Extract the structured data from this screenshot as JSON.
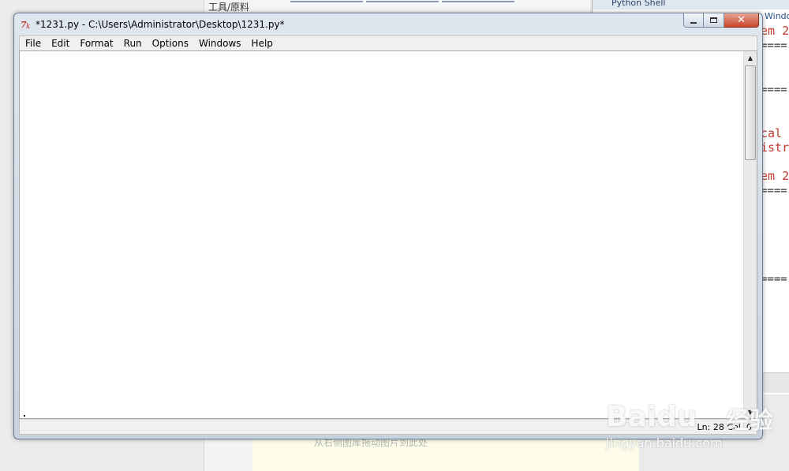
{
  "background": {
    "tool_panel_label": "工具/原料",
    "hint_text": "从右侧图库拖动图片到此处",
    "shell_window_title": "Python Shell",
    "shell_window_caption": "Windo",
    "shell_lines": [
      "em 2",
      "",
      "",
      "",
      " cal",
      "istr",
      "",
      "em 2",
      "",
      "",
      ""
    ]
  },
  "window": {
    "title": "*1231.py - C:\\Users\\Administrator\\Desktop\\1231.py*",
    "controls": {
      "minimize": "",
      "maximize": "",
      "close": "✕"
    }
  },
  "menu": {
    "items": [
      "File",
      "Edit",
      "Format",
      "Run",
      "Options",
      "Windows",
      "Help"
    ]
  },
  "editor": {
    "content": ""
  },
  "status": {
    "text": "Ln: 28 Col: 0"
  },
  "watermark": {
    "brand": "Baidu",
    "brand_cn": "经验",
    "url": "jingyan.baidu.com"
  },
  "colors": {
    "shell_error_red": "#c0392b",
    "close_button": "#c7442a",
    "title_bar": "#dfe6ef"
  }
}
